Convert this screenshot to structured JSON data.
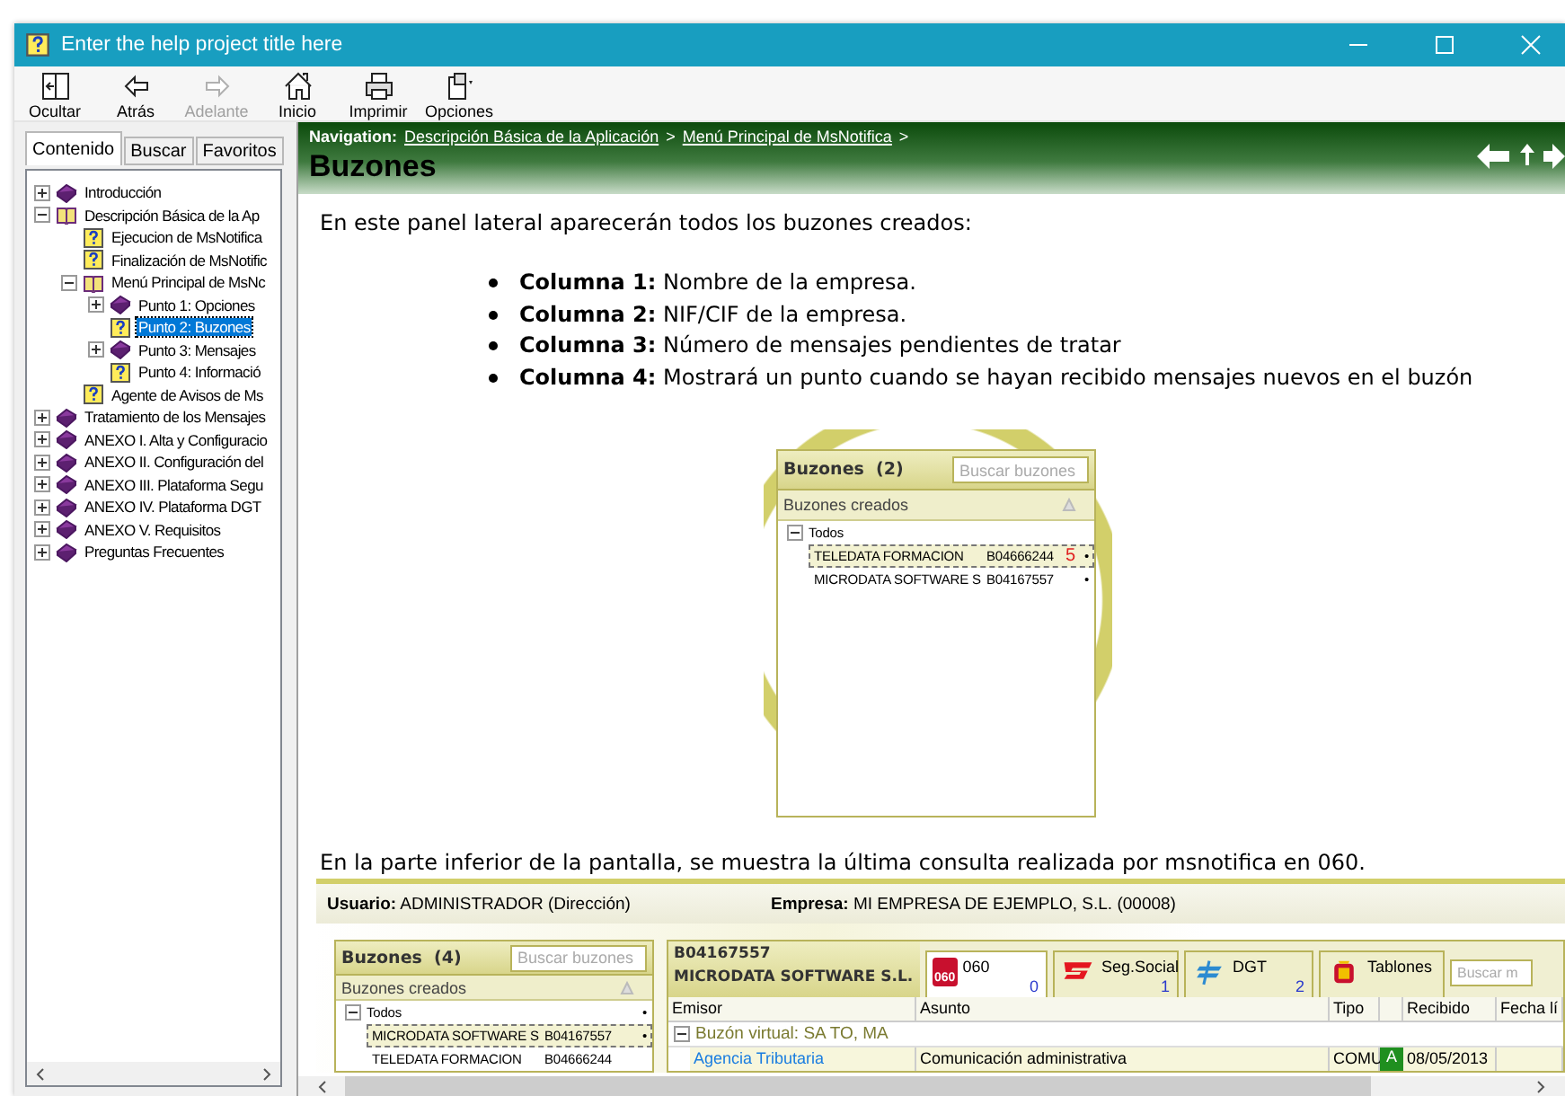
{
  "window": {
    "title": "Enter the help project title here"
  },
  "toolbar": [
    {
      "label": "Ocultar",
      "kind": "hide",
      "disabled": false
    },
    {
      "label": "Atrás",
      "kind": "back",
      "disabled": false
    },
    {
      "label": "Adelante",
      "kind": "forward",
      "disabled": true
    },
    {
      "label": "Inicio",
      "kind": "home",
      "disabled": false
    },
    {
      "label": "Imprimir",
      "kind": "print",
      "disabled": false
    },
    {
      "label": "Opciones",
      "kind": "options",
      "disabled": false
    }
  ],
  "navigation_pane": {
    "tabs": [
      {
        "label": "Contenido",
        "selected": true
      },
      {
        "label": "Buscar",
        "selected": false
      },
      {
        "label": "Favoritos",
        "selected": false
      }
    ],
    "tree": [
      {
        "label": "Introducción",
        "kind": "book",
        "expanded": false,
        "selected": false
      },
      {
        "label": "Descripción Básica de la Ap",
        "kind": "book",
        "expanded": true,
        "selected": false,
        "children": [
          {
            "label": "Ejecucion de MsNotifica",
            "kind": "page",
            "selected": false
          },
          {
            "label": "Finalización de MsNotific",
            "kind": "page",
            "selected": false
          },
          {
            "label": "Menú Principal de MsNc",
            "kind": "book",
            "expanded": true,
            "selected": false,
            "children": [
              {
                "label": "Punto 1: Opciones",
                "kind": "book",
                "expanded": false,
                "selected": false
              },
              {
                "label": "Punto 2: Buzones",
                "kind": "page",
                "selected": true
              },
              {
                "label": "Punto 3: Mensajes",
                "kind": "book",
                "expanded": false,
                "selected": false
              },
              {
                "label": "Punto 4: Informació",
                "kind": "page",
                "selected": false
              }
            ]
          },
          {
            "label": "Agente de Avisos de Ms",
            "kind": "page",
            "selected": false
          }
        ]
      },
      {
        "label": "Tratamiento de los Mensajes",
        "kind": "book",
        "expanded": false,
        "selected": false
      },
      {
        "label": "ANEXO I. Alta y Configuracio",
        "kind": "book",
        "expanded": false,
        "selected": false
      },
      {
        "label": "ANEXO II. Configuración del",
        "kind": "book",
        "expanded": false,
        "selected": false
      },
      {
        "label": "ANEXO III. Plataforma Segu",
        "kind": "book",
        "expanded": false,
        "selected": false
      },
      {
        "label": "ANEXO IV. Plataforma DGT",
        "kind": "book",
        "expanded": false,
        "selected": false
      },
      {
        "label": "ANEXO V. Requisitos",
        "kind": "book",
        "expanded": false,
        "selected": false
      },
      {
        "label": "Preguntas Frecuentes",
        "kind": "book",
        "expanded": false,
        "selected": false
      }
    ]
  },
  "topic": {
    "navigation_label": "Navigation:",
    "breadcrumbs": [
      {
        "label": "Descripción Básica de la Aplicación",
        "separator": ">"
      },
      {
        "label": "Menú Principal de MsNotifica",
        "separator": ">"
      }
    ],
    "title": "Buzones",
    "intro": "En este panel lateral aparecerán todos los buzones creados:",
    "bullets": [
      "**Columna 1:** Nombre de la empresa.",
      "**Columna 2:** NIF/CIF de la empresa.",
      "**Columna 3:** Número de mensajes pendientes de tratar",
      "**Columna 4:** Mostrará un punto cuando se hayan recibido mensajes nuevos en  el buzón"
    ],
    "figure_1": {
      "panel_title": "Buzones  (2)",
      "search_placeholder": "Buscar buzones",
      "column_header": "Buzones creados",
      "root": {
        "label": "Todos",
        "expanded": true
      },
      "rows": [
        {
          "name": "TELEDATA FORMACION",
          "nif": "B04666244",
          "count": "5",
          "dot": "•",
          "selected": true
        },
        {
          "name": "MICRODATA SOFTWARE S",
          "nif": "B04167557",
          "dot": "•",
          "selected": false
        }
      ]
    },
    "paragraph_2": "En la parte inferior de la pantalla, se muestra la última consulta realizada por msnotifica en 060.",
    "figure_2": {
      "user_bar": [
        {
          "label": "Usuario:",
          "value": "ADMINISTRADOR (Dirección)"
        },
        {
          "label": "Empresa:",
          "value": "MI EMPRESA DE EJEMPLO, S.L. (00008)"
        }
      ],
      "mailboxes": {
        "panel_title": "Buzones  (4)",
        "search_placeholder": "Buscar buzones",
        "column_header": "Buzones creados",
        "root": {
          "label": "Todos",
          "expanded": true,
          "dot": "•"
        },
        "rows": [
          {
            "name": "MICRODATA SOFTWARE S",
            "nif": "B04167557",
            "dot": "•",
            "selected": true
          },
          {
            "name": "TELEDATA FORMACION",
            "nif": "B04666244",
            "selected": false
          }
        ]
      },
      "detail": {
        "nif": "B04167557",
        "company": "MICRODATA SOFTWARE S.L.",
        "services": [
          {
            "label": "060",
            "kind": "gov",
            "badge": "060",
            "count": "0",
            "selected": true
          },
          {
            "label": "Seg.Social",
            "kind": "seg",
            "count": "1",
            "selected": false
          },
          {
            "label": "DGT",
            "kind": "dgt",
            "count": "2",
            "selected": false
          },
          {
            "label": "Tablones",
            "kind": "tablones",
            "selected": false
          }
        ],
        "search_placeholder": "Buscar m",
        "columns": [
          "Emisor",
          "Asunto",
          "Tipo",
          "Recibido",
          "Fecha lí"
        ],
        "group": {
          "label": "Buzón virtual: SA TO, MA",
          "expanded": true
        },
        "rows": [
          {
            "sender": "Agencia Tributaria",
            "subject": "Comunicación administrativa",
            "type": "COMU",
            "status": "A",
            "received": "08/05/2013"
          }
        ]
      }
    }
  }
}
